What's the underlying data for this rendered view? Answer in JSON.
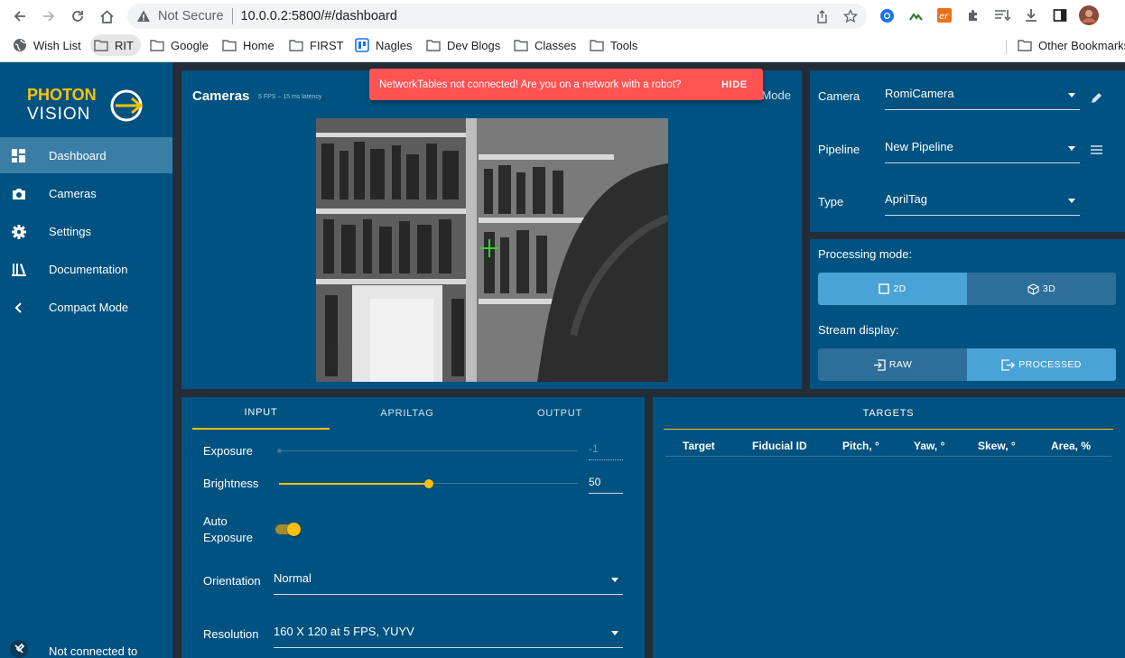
{
  "browser": {
    "security_label": "Not Secure",
    "url": "10.0.0.2:5800/#/dashboard",
    "bookmarks": [
      "Wish List",
      "RIT",
      "Google",
      "Home",
      "FIRST",
      "Nagles",
      "Dev Blogs",
      "Classes",
      "Tools"
    ],
    "other_bookmarks": "Other Bookmarks"
  },
  "sidebar": {
    "logo_line1": "PHOTON",
    "logo_line2": "VISION",
    "items": [
      {
        "label": "Dashboard",
        "icon": "dashboard-icon"
      },
      {
        "label": "Cameras",
        "icon": "camera-icon"
      },
      {
        "label": "Settings",
        "icon": "gear-icon"
      },
      {
        "label": "Documentation",
        "icon": "library-icon"
      },
      {
        "label": "Compact Mode",
        "icon": "chevron-left-icon"
      }
    ],
    "footer_status": "Not connected to"
  },
  "cameras_card": {
    "title": "Cameras",
    "subtitle": "5 FPS – 15 ms latency",
    "mode_label": "Mode"
  },
  "snackbar": {
    "message": "NetworkTables not connected! Are you on a network with a robot?",
    "action": "HIDE"
  },
  "config": {
    "camera_label": "Camera",
    "camera_value": "RomiCamera",
    "pipeline_label": "Pipeline",
    "pipeline_value": "New Pipeline",
    "type_label": "Type",
    "type_value": "AprilTag"
  },
  "processing": {
    "mode_label": "Processing mode:",
    "mode_2d": "2D",
    "mode_3d": "3D",
    "stream_label": "Stream display:",
    "raw": "RAW",
    "processed": "PROCESSED"
  },
  "input": {
    "tabs": [
      "INPUT",
      "APRILTAG",
      "OUTPUT"
    ],
    "exposure_label": "Exposure",
    "exposure_value": "-1",
    "brightness_label": "Brightness",
    "brightness_value": "50",
    "brightness_level": 0.5,
    "auto_exposure_line1": "Auto",
    "auto_exposure_line2": "Exposure",
    "orientation_label": "Orientation",
    "orientation_value": "Normal",
    "resolution_label": "Resolution",
    "resolution_value": "160 X 120 at 5 FPS, YUYV"
  },
  "targets": {
    "title": "TARGETS",
    "columns": [
      "Target",
      "Fiducial ID",
      "Pitch, °",
      "Yaw, °",
      "Skew, °",
      "Area, %"
    ]
  },
  "colors": {
    "panel": "#005280",
    "accent": "#ffc107",
    "snackbar": "#ff5252",
    "segment_active": "#4aa3d6"
  }
}
